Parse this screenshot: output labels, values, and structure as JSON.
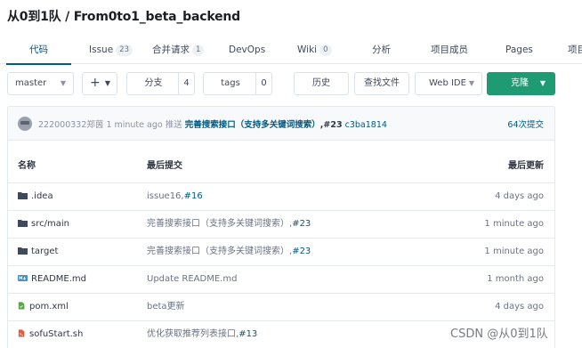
{
  "repo": {
    "title": "从0到1队 / From0to1_beta_backend"
  },
  "tabs": [
    {
      "label": "代码",
      "count": null
    },
    {
      "label": "Issue",
      "count": "23"
    },
    {
      "label": "合并请求",
      "count": "1"
    },
    {
      "label": "DevOps",
      "count": null
    },
    {
      "label": "Wiki",
      "count": "0"
    },
    {
      "label": "分析",
      "count": null
    },
    {
      "label": "项目成员",
      "count": null
    },
    {
      "label": "Pages",
      "count": null
    },
    {
      "label": "项目",
      "count": null
    }
  ],
  "toolbar": {
    "branch": "master",
    "add_symbol": "+",
    "branches_label": "分支",
    "branches_count": "4",
    "tags_label": "tags",
    "tags_count": "0",
    "history_label": "历史",
    "search_label": "查找文件",
    "webide_label": "Web IDE",
    "clone_label": "克隆"
  },
  "latest_commit": {
    "author": "222000332郑茵",
    "time": "1 minute ago",
    "action": "推送",
    "message": "完善搜索接口（支持多关键词搜索）",
    "issue": ",#23",
    "sha": "c3ba1814",
    "commits_count": "64次提交"
  },
  "table": {
    "col_name": "名称",
    "col_commit": "最后提交",
    "col_updated": "最后更新",
    "rows": [
      {
        "name": ".idea",
        "icon": "folder-icon",
        "msg": "issue16,",
        "ref": "#16",
        "time": "4 days ago"
      },
      {
        "name": "src/main",
        "icon": "folder-icon",
        "msg": "完善搜索接口（支持多关键词搜索）,",
        "ref": "#23",
        "time": "1 minute ago"
      },
      {
        "name": "target",
        "icon": "folder-icon",
        "msg": "完善搜索接口（支持多关键词搜索）,",
        "ref": "#23",
        "time": "1 minute ago"
      },
      {
        "name": "README.md",
        "icon": "markdown-icon",
        "msg": "Update README.md",
        "ref": "",
        "time": "1 month ago"
      },
      {
        "name": "pom.xml",
        "icon": "xml-file-icon",
        "msg": "beta更新",
        "ref": "",
        "time": "4 days ago"
      },
      {
        "name": "sofuStart.sh",
        "icon": "shell-file-icon",
        "msg": "优化获取推荐列表接口,",
        "ref": "#13",
        "time": ""
      }
    ]
  },
  "watermark": "CSDN @从0到1队",
  "colors": {
    "accent": "#005980",
    "clone_green": "#1e9b73",
    "border": "#e3e9ed"
  }
}
